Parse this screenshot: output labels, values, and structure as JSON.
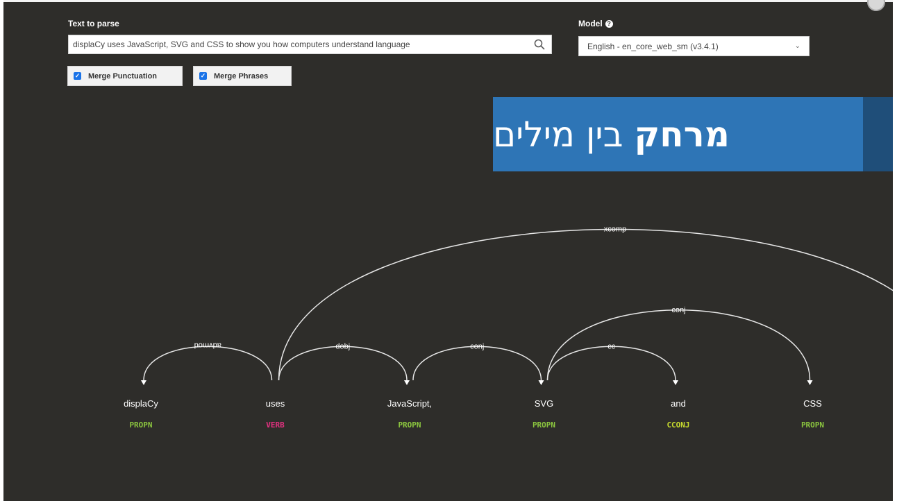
{
  "form": {
    "text_label": "Text to parse",
    "text_value": "displaCy uses JavaScript, SVG and CSS to show you how computers understand language",
    "model_label": "Model",
    "model_value": "English - en_core_web_sm (v3.4.1)",
    "merge_punctuation": {
      "label": "Merge Punctuation",
      "checked": true
    },
    "merge_phrases": {
      "label": "Merge Phrases",
      "checked": true
    }
  },
  "overlay": {
    "title_bold": "מרחק",
    "title_rest": "בין מילים",
    "color": "#2e75b6",
    "strip_color": "#1f4e79"
  },
  "parse": {
    "words": [
      {
        "text": "displaCy",
        "tag": "PROPN"
      },
      {
        "text": "uses",
        "tag": "VERB"
      },
      {
        "text": "JavaScript,",
        "tag": "PROPN"
      },
      {
        "text": "SVG",
        "tag": "PROPN"
      },
      {
        "text": "and",
        "tag": "CCONJ"
      },
      {
        "text": "CSS",
        "tag": "PROPN"
      }
    ],
    "tag_colors": {
      "PROPN": "#8cc63f",
      "VERB": "#e0317f",
      "CCONJ": "#c8dc2e"
    },
    "arcs": [
      {
        "label": "advmod",
        "start": 0,
        "end": 1,
        "dir": "left"
      },
      {
        "label": "dobj",
        "start": 1,
        "end": 2,
        "dir": "right"
      },
      {
        "label": "conj",
        "start": 2,
        "end": 3,
        "dir": "right"
      },
      {
        "label": "cc",
        "start": 3,
        "end": 4,
        "dir": "right"
      },
      {
        "label": "conj",
        "start": 3,
        "end": 5,
        "dir": "right"
      },
      {
        "label": "xcomp",
        "start": 1,
        "end": 6,
        "dir": "right"
      }
    ]
  }
}
